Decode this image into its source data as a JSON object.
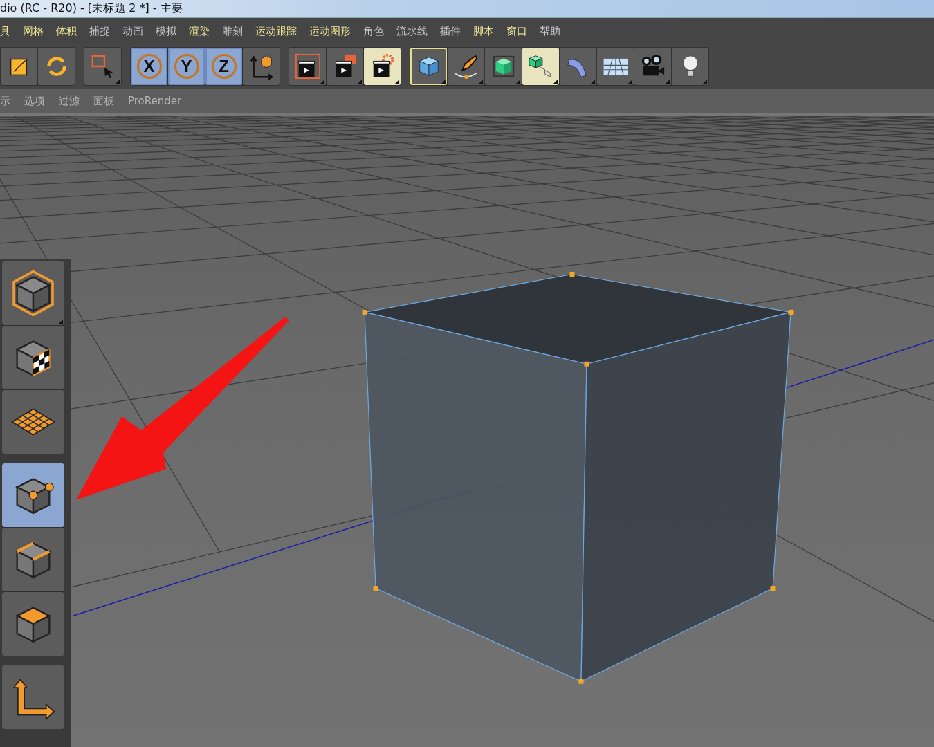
{
  "window": {
    "title": "dio (RC - R20) - [未标题 2 *] - 主要"
  },
  "menu": [
    {
      "label": "具",
      "highlight": true
    },
    {
      "label": "网格",
      "highlight": true
    },
    {
      "label": "体积",
      "highlight": true
    },
    {
      "label": "捕捉",
      "highlight": false
    },
    {
      "label": "动画",
      "highlight": false
    },
    {
      "label": "模拟",
      "highlight": false
    },
    {
      "label": "渲染",
      "highlight": true
    },
    {
      "label": "雕刻",
      "highlight": false
    },
    {
      "label": "运动跟踪",
      "highlight": true
    },
    {
      "label": "运动图形",
      "highlight": true
    },
    {
      "label": "角色",
      "highlight": false
    },
    {
      "label": "流水线",
      "highlight": false
    },
    {
      "label": "插件",
      "highlight": false
    },
    {
      "label": "脚本",
      "highlight": true
    },
    {
      "label": "窗口",
      "highlight": true
    },
    {
      "label": "帮助",
      "highlight": false
    }
  ],
  "toolbar": [
    [
      {
        "kind": "scale",
        "selected": false,
        "active": false,
        "focused": false
      },
      {
        "kind": "rotate",
        "selected": false,
        "active": false,
        "focused": false
      }
    ],
    [
      {
        "kind": "select",
        "selected": false,
        "active": false,
        "focused": false
      }
    ],
    [
      {
        "kind": "axis",
        "label": "X",
        "selected": true,
        "active": false,
        "focused": false
      },
      {
        "kind": "axis",
        "label": "Y",
        "selected": true,
        "active": false,
        "focused": false
      },
      {
        "kind": "axis",
        "label": "Z",
        "selected": true,
        "active": false,
        "focused": false
      },
      {
        "kind": "coord",
        "selected": false,
        "active": false,
        "focused": false
      }
    ],
    [
      {
        "kind": "render-view",
        "selected": false,
        "active": false,
        "focused": false
      },
      {
        "kind": "render-picture",
        "selected": false,
        "active": false,
        "focused": false
      },
      {
        "kind": "render-settings",
        "selected": false,
        "active": true,
        "focused": false
      }
    ],
    [
      {
        "kind": "cube",
        "selected": false,
        "active": false,
        "focused": true
      },
      {
        "kind": "pen",
        "selected": false,
        "active": false,
        "focused": false
      },
      {
        "kind": "subdivision",
        "selected": false,
        "active": false,
        "focused": false
      },
      {
        "kind": "cloner",
        "selected": false,
        "active": true,
        "focused": false
      },
      {
        "kind": "bend",
        "selected": false,
        "active": false,
        "focused": false
      },
      {
        "kind": "floor",
        "selected": false,
        "active": false,
        "focused": false
      },
      {
        "kind": "camera",
        "selected": false,
        "active": false,
        "focused": false
      },
      {
        "kind": "light",
        "selected": false,
        "active": false,
        "focused": false
      }
    ]
  ],
  "viewport_menu": [
    "示",
    "选项",
    "过滤",
    "面板",
    "ProRender"
  ],
  "mode_palette": [
    [
      {
        "kind": "model",
        "selected": false
      },
      {
        "kind": "texture",
        "selected": false
      },
      {
        "kind": "workplane",
        "selected": false
      }
    ],
    [
      {
        "kind": "points",
        "selected": true
      },
      {
        "kind": "edges",
        "selected": false
      },
      {
        "kind": "polygons",
        "selected": false
      }
    ],
    [
      {
        "kind": "axis",
        "selected": false
      }
    ]
  ]
}
